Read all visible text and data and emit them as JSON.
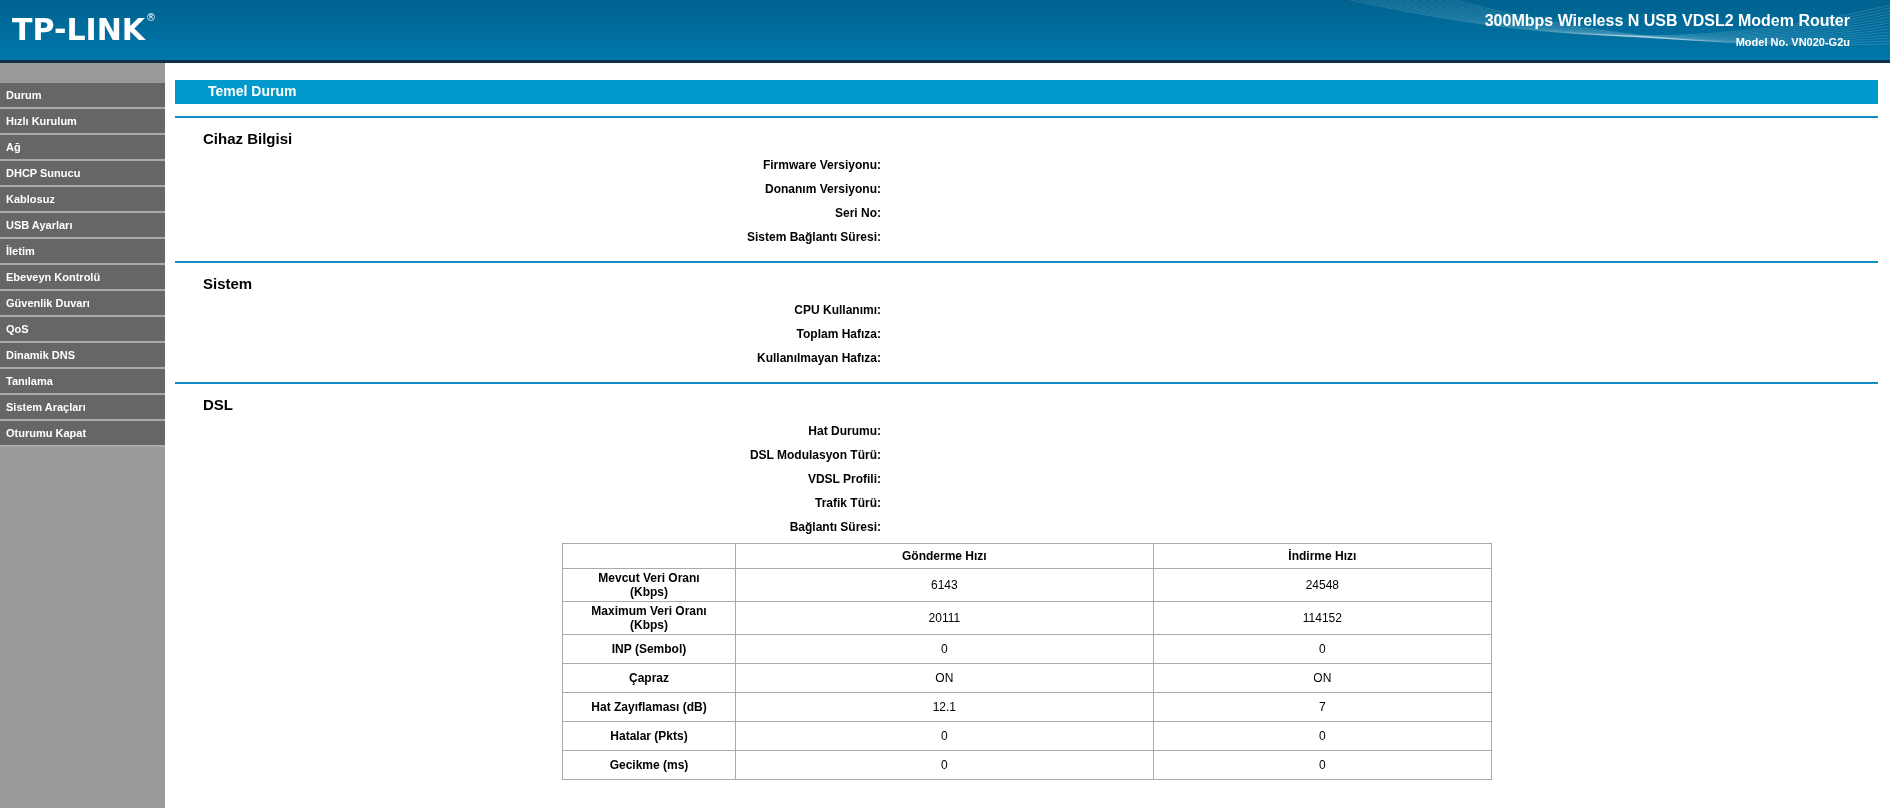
{
  "header": {
    "logo": "TP-LINK",
    "logo_mark": "®",
    "product": "300Mbps Wireless N USB VDSL2 Modem Router",
    "model": "Model No. VN020-G2u"
  },
  "sidebar": {
    "items": [
      {
        "label": "Durum"
      },
      {
        "label": "Hızlı Kurulum"
      },
      {
        "label": "Ağ"
      },
      {
        "label": "DHCP Sunucu"
      },
      {
        "label": "Kablosuz"
      },
      {
        "label": "USB Ayarları"
      },
      {
        "label": "İletim"
      },
      {
        "label": "Ebeveyn Kontrolü"
      },
      {
        "label": "Güvenlik Duvarı"
      },
      {
        "label": "QoS"
      },
      {
        "label": "Dinamik DNS"
      },
      {
        "label": "Tanılama"
      },
      {
        "label": "Sistem Araçları"
      },
      {
        "label": "Oturumu Kapat"
      }
    ]
  },
  "page_title": "Temel Durum",
  "sections": [
    {
      "title": "Cihaz Bilgisi",
      "fields": [
        "Firmware Versiyonu:",
        "Donanım Versiyonu:",
        "Seri No:",
        "Sistem Bağlantı Süresi:"
      ]
    },
    {
      "title": "Sistem",
      "fields": [
        "CPU Kullanımı:",
        "Toplam Hafıza:",
        "Kullanılmayan Hafıza:"
      ]
    },
    {
      "title": "DSL",
      "fields": [
        "Hat Durumu:",
        "DSL Modulasyon Türü:",
        "VDSL Profili:",
        "Trafik Türü:",
        "Bağlantı Süresi:"
      ],
      "table": {
        "columns": [
          "Gönderme Hızı",
          "İndirme Hızı"
        ],
        "rows": [
          {
            "label": "Mevcut Veri Oranı\n(Kbps)",
            "cells": [
              "6143",
              "24548"
            ]
          },
          {
            "label": "Maximum Veri Oranı\n(Kbps)",
            "cells": [
              "20111",
              "114152"
            ]
          },
          {
            "label": "INP (Sembol)",
            "cells": [
              "0",
              "0"
            ]
          },
          {
            "label": "Çapraz",
            "cells": [
              "ON",
              "ON"
            ]
          },
          {
            "label": "Hat Zayıflaması (dB)",
            "cells": [
              "12.1",
              "7"
            ]
          },
          {
            "label": "Hatalar (Pkts)",
            "cells": [
              "0",
              "0"
            ]
          },
          {
            "label": "Gecikme (ms)",
            "cells": [
              "0",
              "0"
            ]
          }
        ]
      }
    }
  ]
}
